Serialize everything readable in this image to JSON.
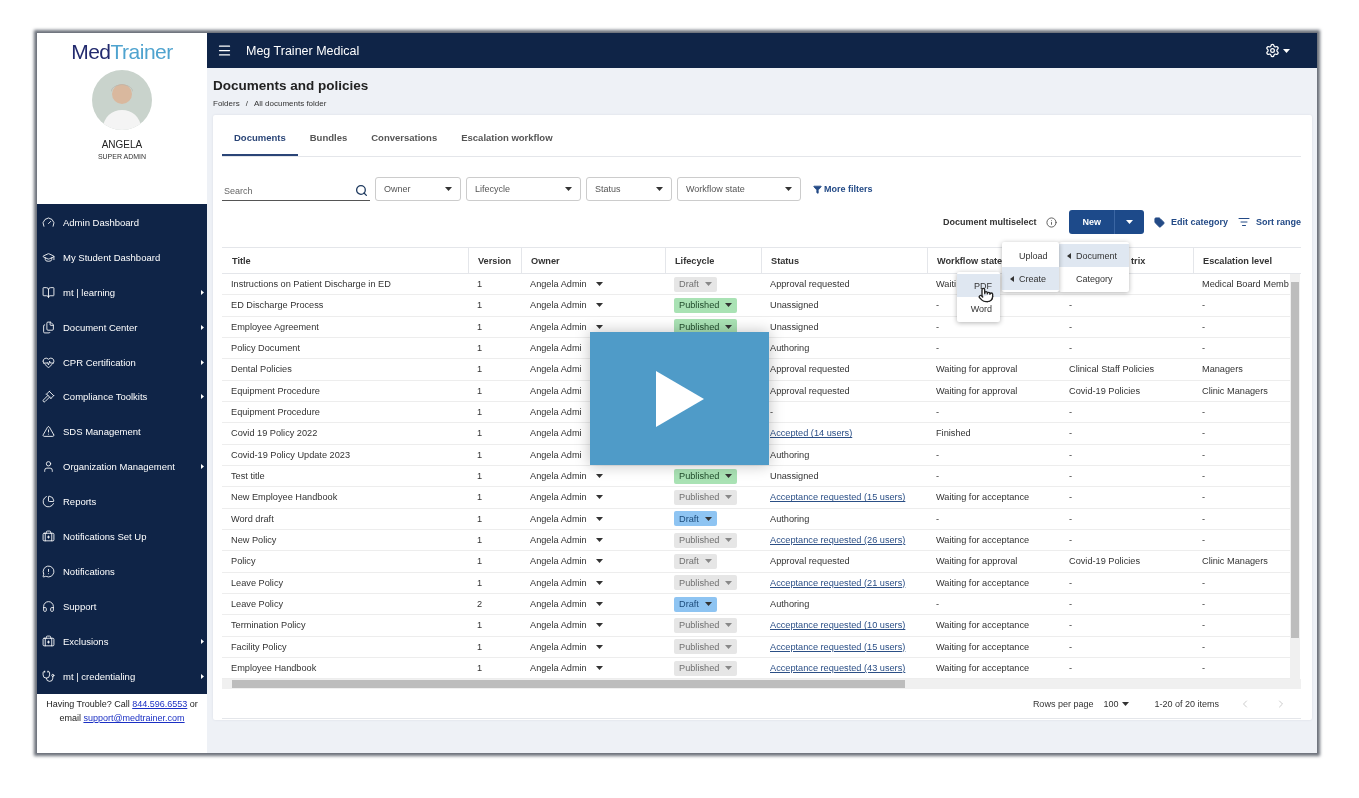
{
  "sidebar": {
    "logo": {
      "parts": [
        "Med",
        "Trainer"
      ]
    },
    "user": {
      "name": "ANGELA",
      "role": "SUPER ADMIN"
    },
    "items": [
      {
        "label": "Admin Dashboard",
        "has_submenu": false
      },
      {
        "label": "My Student Dashboard",
        "has_submenu": false
      },
      {
        "label": "mt | learning",
        "has_submenu": true
      },
      {
        "label": "Document Center",
        "has_submenu": true
      },
      {
        "label": "CPR Certification",
        "has_submenu": true
      },
      {
        "label": "Compliance Toolkits",
        "has_submenu": true
      },
      {
        "label": "SDS Management",
        "has_submenu": false
      },
      {
        "label": "Organization Management",
        "has_submenu": true
      },
      {
        "label": "Reports",
        "has_submenu": false
      },
      {
        "label": "Notifications Set Up",
        "has_submenu": false
      },
      {
        "label": "Notifications",
        "has_submenu": false
      },
      {
        "label": "Support",
        "has_submenu": false
      },
      {
        "label": "Exclusions",
        "has_submenu": true
      },
      {
        "label": "mt | credentialing",
        "has_submenu": true
      }
    ],
    "help": {
      "text_before": "Having Trouble? Call",
      "phone": "844.596.6553",
      "text_middle": "or",
      "text_after": "email",
      "email": "support@medtrainer.com"
    }
  },
  "topbar": {
    "title": "Meg Trainer Medical"
  },
  "page": {
    "title": "Documents and policies",
    "breadcrumb": {
      "items": [
        "Folders",
        "All documents folder"
      ],
      "separator": "/"
    }
  },
  "tabs": [
    {
      "label": "Documents",
      "selected": true
    },
    {
      "label": "Bundles",
      "selected": false
    },
    {
      "label": "Conversations",
      "selected": false
    },
    {
      "label": "Escalation workflow",
      "selected": false
    }
  ],
  "filters": {
    "search": {
      "placeholder": "Search"
    },
    "dropdowns": [
      "Owner",
      "Lifecycle",
      "Status",
      "Workflow state"
    ],
    "more": "More filters"
  },
  "toolbar": {
    "multiselect": "Document multiselect",
    "new_button": "New",
    "edit_category": "Edit category",
    "sort_range": "Sort range"
  },
  "new_menu": {
    "items": [
      {
        "label": "Document",
        "selected": true,
        "submenu": true
      },
      {
        "label": "Category",
        "selected": false,
        "submenu": false
      }
    ]
  },
  "document_menu": {
    "items": [
      {
        "label": "Upload",
        "selected": false,
        "submenu": false
      },
      {
        "label": "Create",
        "selected": true,
        "submenu": true
      }
    ]
  },
  "create_menu": {
    "items": [
      {
        "label": "PDF",
        "selected": true,
        "submenu": false
      },
      {
        "label": "Word",
        "selected": false,
        "submenu": false
      }
    ]
  },
  "table": {
    "columns": [
      {
        "label": "Title"
      },
      {
        "label": "Version"
      },
      {
        "label": "Owner"
      },
      {
        "label": "Lifecycle"
      },
      {
        "label": "Status"
      },
      {
        "label": "Workflow state"
      },
      {
        "label": "trix",
        "cut": true
      },
      {
        "label": "Escalation level"
      }
    ],
    "rows": [
      {
        "title": "Instructions on Patient Discharge in ED",
        "version": "1",
        "owner": "Angela Admin",
        "lifecycle": {
          "label": "Draft",
          "kind": "draft",
          "disabled": true
        },
        "status": {
          "text": "Approval requested",
          "link": false
        },
        "workflow": "Waiti",
        "column_7": "",
        "escalation": "Medical Board Memb"
      },
      {
        "title": "ED Discharge Process",
        "version": "1",
        "owner": "Angela Admin",
        "lifecycle": {
          "label": "Published",
          "kind": "published",
          "disabled": false
        },
        "status": {
          "text": "Unassigned",
          "link": false
        },
        "workflow": "-",
        "column_7": "-",
        "escalation": "-"
      },
      {
        "title": "Employee Agreement",
        "version": "1",
        "owner": "Angela Admin",
        "lifecycle": {
          "label": "Published",
          "kind": "published",
          "disabled": false
        },
        "status": {
          "text": "Unassigned",
          "link": false
        },
        "workflow": "-",
        "column_7": "-",
        "escalation": "-"
      },
      {
        "title": "Policy Document",
        "version": "1",
        "owner": "Angela Admi",
        "owner_caret": false,
        "status": {
          "text": "Authoring",
          "link": false
        },
        "workflow": "-",
        "column_7": "-",
        "escalation": "-"
      },
      {
        "title": "Dental Policies",
        "version": "1",
        "owner": "Angela Admi",
        "owner_caret": false,
        "status": {
          "text": "Approval requested",
          "link": false
        },
        "workflow": "Waiting for approval",
        "column_7": "Clinical Staff Policies",
        "escalation": "Managers"
      },
      {
        "title": "Equipment Procedure",
        "version": "1",
        "owner": "Angela Admi",
        "owner_caret": false,
        "status": {
          "text": "Approval requested",
          "link": false
        },
        "workflow": "Waiting for approval",
        "column_7": "Covid-19 Policies",
        "escalation": "Clinic Managers"
      },
      {
        "title": "Equipment Procedure",
        "version": "1",
        "owner": "Angela Admi",
        "owner_caret": false,
        "status": {
          "text": "-",
          "link": false
        },
        "workflow": "-",
        "column_7": "-",
        "escalation": "-"
      },
      {
        "title": "Covid 19 Policy 2022",
        "version": "1",
        "owner": "Angela Admi",
        "owner_caret": false,
        "status": {
          "text": "Accepted (14 users)",
          "link": true
        },
        "workflow": "Finished",
        "column_7": "-",
        "escalation": "-"
      },
      {
        "title": "Covid-19 Policy Update 2023",
        "version": "1",
        "owner": "Angela Admi",
        "owner_caret": false,
        "status": {
          "text": "Authoring",
          "link": false
        },
        "workflow": "-",
        "column_7": "-",
        "escalation": "-"
      },
      {
        "title": "Test title",
        "version": "1",
        "owner": "Angela Admin",
        "lifecycle": {
          "label": "Published",
          "kind": "published",
          "disabled": false
        },
        "status": {
          "text": "Unassigned",
          "link": false
        },
        "workflow": "-",
        "column_7": "-",
        "escalation": "-"
      },
      {
        "title": "New Employee Handbook",
        "version": "1",
        "owner": "Angela Admin",
        "lifecycle": {
          "label": "Published",
          "kind": "published",
          "disabled": true
        },
        "status": {
          "text": "Acceptance requested (15 users)",
          "link": true
        },
        "workflow": "Waiting for acceptance",
        "column_7": "-",
        "escalation": "-"
      },
      {
        "title": "Word draft",
        "version": "1",
        "owner": "Angela Admin",
        "lifecycle": {
          "label": "Draft",
          "kind": "draft",
          "disabled": false
        },
        "status": {
          "text": "Authoring",
          "link": false
        },
        "workflow": "-",
        "column_7": "-",
        "escalation": "-"
      },
      {
        "title": "New Policy",
        "version": "1",
        "owner": "Angela Admin",
        "lifecycle": {
          "label": "Published",
          "kind": "published",
          "disabled": true
        },
        "status": {
          "text": "Acceptance requested (26 users)",
          "link": true
        },
        "workflow": "Waiting for acceptance",
        "column_7": "-",
        "escalation": "-"
      },
      {
        "title": "Policy",
        "version": "1",
        "owner": "Angela Admin",
        "lifecycle": {
          "label": "Draft",
          "kind": "draft",
          "disabled": true
        },
        "status": {
          "text": "Approval requested",
          "link": false
        },
        "workflow": "Waiting for approval",
        "column_7": "Covid-19 Policies",
        "escalation": "Clinic Managers"
      },
      {
        "title": "Leave Policy",
        "version": "1",
        "owner": "Angela Admin",
        "lifecycle": {
          "label": "Published",
          "kind": "published",
          "disabled": true
        },
        "status": {
          "text": "Acceptance requested (21 users)",
          "link": true
        },
        "workflow": "Waiting for acceptance",
        "column_7": "-",
        "escalation": "-"
      },
      {
        "title": "Leave Policy",
        "version": "2",
        "owner": "Angela Admin",
        "lifecycle": {
          "label": "Draft",
          "kind": "draft",
          "disabled": false
        },
        "status": {
          "text": "Authoring",
          "link": false
        },
        "workflow": "-",
        "column_7": "-",
        "escalation": "-"
      },
      {
        "title": "Termination Policy",
        "version": "1",
        "owner": "Angela Admin",
        "lifecycle": {
          "label": "Published",
          "kind": "published",
          "disabled": true
        },
        "status": {
          "text": "Acceptance requested (10 users)",
          "link": true
        },
        "workflow": "Waiting for acceptance",
        "column_7": "-",
        "escalation": "-"
      },
      {
        "title": "Facility Policy",
        "version": "1",
        "owner": "Angela Admin",
        "lifecycle": {
          "label": "Published",
          "kind": "published",
          "disabled": true
        },
        "status": {
          "text": "Acceptance requested (15 users)",
          "link": true
        },
        "workflow": "Waiting for acceptance",
        "column_7": "-",
        "escalation": "-"
      },
      {
        "title": "Employee Handbook",
        "version": "1",
        "owner": "Angela Admin",
        "lifecycle": {
          "label": "Published",
          "kind": "published",
          "disabled": true
        },
        "status": {
          "text": "Acceptance requested (43 users)",
          "link": true
        },
        "workflow": "Waiting for acceptance",
        "column_7": "-",
        "escalation": "-"
      }
    ]
  },
  "pagination": {
    "rows_label": "Rows per page",
    "rows_value": "100",
    "range": "1-20 of 20 items"
  },
  "video_overlay": {
    "kind": "play"
  }
}
